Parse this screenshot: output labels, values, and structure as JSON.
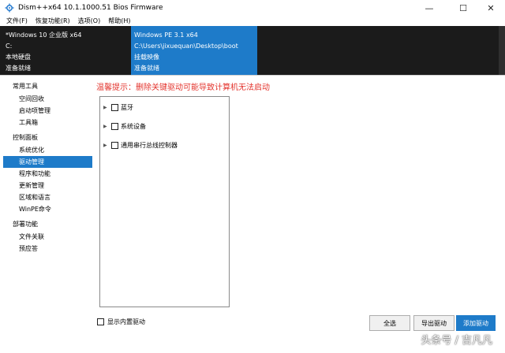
{
  "window": {
    "title": "Dism++x64 10.1.1000.51 Bios Firmware",
    "controls": {
      "minimize": "—",
      "maximize": "☐",
      "close": "✕"
    }
  },
  "menu": [
    "文件(F)",
    "恢复功能(R)",
    "选项(O)",
    "帮助(H)"
  ],
  "sessions": [
    {
      "lines": [
        "*Windows 10 企业版 x64",
        "C:",
        "本地硬盘",
        "准备就绪"
      ]
    },
    {
      "lines": [
        "Windows PE 3.1 x64",
        "C:\\Users\\jixuequan\\Desktop\\boot",
        "挂载映像",
        "准备就绪"
      ]
    }
  ],
  "sidebar": {
    "groups": [
      {
        "label": "常用工具",
        "items": [
          "空间回收",
          "启动项管理",
          "工具箱"
        ]
      },
      {
        "label": "控制面板",
        "items": [
          "系统优化",
          "驱动管理",
          "程序和功能",
          "更新管理",
          "区域和语言",
          "WinPE命令"
        ]
      },
      {
        "label": "部署功能",
        "items": [
          "文件关联",
          "预应答"
        ]
      }
    ],
    "active": "驱动管理"
  },
  "warning": "温馨提示：删除关键驱动可能导致计算机无法启动",
  "tree": [
    "蓝牙",
    "系统设备",
    "通用串行总线控制器"
  ],
  "bottom": {
    "show_builtin": "显示内置驱动",
    "select_all": "全选",
    "export": "导出驱动",
    "add": "添加驱动"
  },
  "watermark": "头条号 / 吉凡凡",
  "colors": {
    "accent": "#1e7bc9",
    "warning": "#e3332c",
    "session_bg": "#1b1b1b"
  }
}
